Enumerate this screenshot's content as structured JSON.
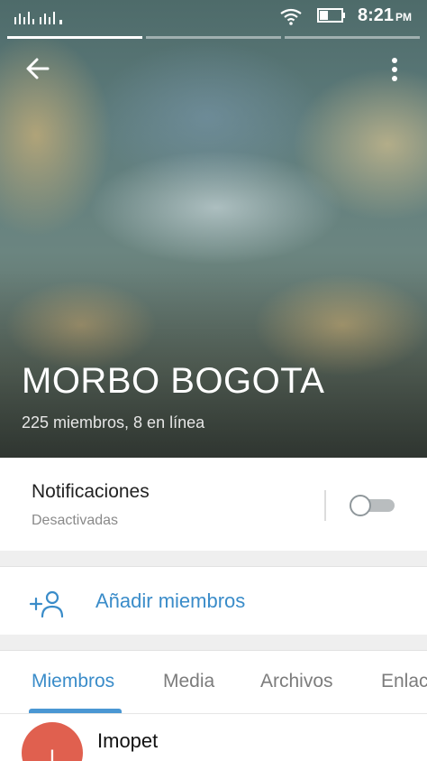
{
  "status_bar": {
    "time": "8:21",
    "ampm": "PM"
  },
  "header": {
    "group_name": "MORBO BOGOTA",
    "subtitle": "225 miembros, 8 en línea"
  },
  "notifications": {
    "title": "Notificaciones",
    "status": "Desactivadas",
    "enabled": false
  },
  "add_members": {
    "label": "Añadir miembros"
  },
  "tabs": [
    {
      "label": "Miembros",
      "active": true
    },
    {
      "label": "Media",
      "active": false
    },
    {
      "label": "Archivos",
      "active": false
    },
    {
      "label": "Enlaces",
      "active": false
    }
  ],
  "members": [
    {
      "name": "Imopet",
      "initial": "I"
    }
  ],
  "colors": {
    "accent": "#3a8cc9",
    "tab_indicator": "#4a97d3",
    "avatar": "#e0604f",
    "toggle_off": "#b9bdbf"
  },
  "icons": [
    "back-arrow-icon",
    "more-vert-icon",
    "add-member-icon",
    "signal-icon",
    "wifi-icon",
    "battery-icon"
  ]
}
